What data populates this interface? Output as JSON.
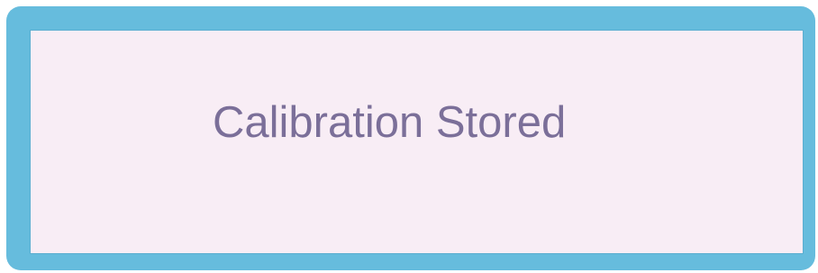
{
  "dialog": {
    "message": "Calibration Stored"
  },
  "colors": {
    "frame": "#66bcdd",
    "panel": "#f8edf5",
    "text": "#7b6f99"
  }
}
